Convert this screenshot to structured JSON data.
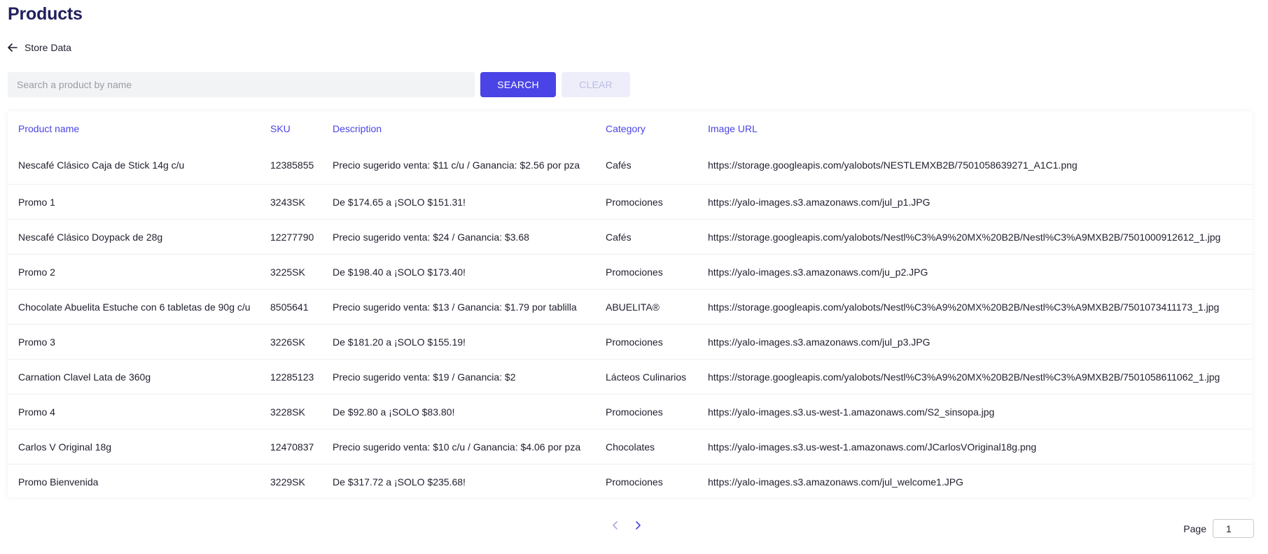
{
  "page": {
    "title": "Products"
  },
  "nav": {
    "back_label": "Store Data",
    "back_icon": "arrow-left-icon"
  },
  "search": {
    "placeholder": "Search a product by name",
    "value": "",
    "search_label": "SEARCH",
    "clear_label": "CLEAR"
  },
  "colors": {
    "accent": "#4a44e6",
    "title": "#221f5e",
    "clear_bg": "#eeeefb",
    "clear_text": "#bdbbe4"
  },
  "table": {
    "headers": {
      "name": "Product name",
      "sku": "SKU",
      "description": "Description",
      "category": "Category",
      "image_url": "Image URL"
    },
    "rows": [
      {
        "name": "Nescafé Clásico Caja de Stick 14g c/u",
        "sku": "12385855",
        "description": "Precio sugerido venta: $11 c/u / Ganancia: $2.56 por pza",
        "category": "Cafés",
        "image_url": "https://storage.googleapis.com/yalobots/NESTLEMXB2B/7501058639271_A1C1.png"
      },
      {
        "name": "Promo 1",
        "sku": "3243SK",
        "description": "De $174.65 a ¡SOLO $151.31!",
        "category": "Promociones",
        "image_url": "https://yalo-images.s3.amazonaws.com/jul_p1.JPG"
      },
      {
        "name": "Nescafé Clásico Doypack de 28g",
        "sku": "12277790",
        "description": "Precio sugerido venta: $24 / Ganancia: $3.68",
        "category": "Cafés",
        "image_url": "https://storage.googleapis.com/yalobots/Nestl%C3%A9%20MX%20B2B/Nestl%C3%A9MXB2B/7501000912612_1.jpg"
      },
      {
        "name": "Promo 2",
        "sku": "3225SK",
        "description": "De $198.40 a ¡SOLO $173.40!",
        "category": "Promociones",
        "image_url": "https://yalo-images.s3.amazonaws.com/ju_p2.JPG"
      },
      {
        "name": "Chocolate Abuelita Estuche con 6 tabletas de 90g c/u",
        "sku": "8505641",
        "description": "Precio sugerido venta: $13 / Ganancia: $1.79 por tablilla",
        "category": "ABUELITA®",
        "image_url": "https://storage.googleapis.com/yalobots/Nestl%C3%A9%20MX%20B2B/Nestl%C3%A9MXB2B/7501073411173_1.jpg"
      },
      {
        "name": "Promo 3",
        "sku": "3226SK",
        "description": "De $181.20 a ¡SOLO $155.19!",
        "category": "Promociones",
        "image_url": "https://yalo-images.s3.amazonaws.com/jul_p3.JPG"
      },
      {
        "name": "Carnation Clavel Lata de 360g",
        "sku": "12285123",
        "description": "Precio sugerido venta: $19 / Ganancia: $2",
        "category": "Lácteos Culinarios",
        "image_url": "https://storage.googleapis.com/yalobots/Nestl%C3%A9%20MX%20B2B/Nestl%C3%A9MXB2B/7501058611062_1.jpg"
      },
      {
        "name": "Promo 4",
        "sku": "3228SK",
        "description": "De $92.80 a ¡SOLO $83.80!",
        "category": "Promociones",
        "image_url": "https://yalo-images.s3.us-west-1.amazonaws.com/S2_sinsopa.jpg"
      },
      {
        "name": "Carlos V Original 18g",
        "sku": "12470837",
        "description": "Precio sugerido venta: $10 c/u / Ganancia: $4.06 por pza",
        "category": "Chocolates",
        "image_url": "https://yalo-images.s3.us-west-1.amazonaws.com/JCarlosVOriginal18g.png"
      },
      {
        "name": "Promo Bienvenida",
        "sku": "3229SK",
        "description": "De $317.72 a ¡SOLO $235.68!",
        "category": "Promociones",
        "image_url": "https://yalo-images.s3.amazonaws.com/jul_welcome1.JPG"
      }
    ]
  },
  "pagination": {
    "prev_icon": "chevron-left-icon",
    "next_icon": "chevron-right-icon",
    "page_label": "Page",
    "page_value": "1"
  }
}
